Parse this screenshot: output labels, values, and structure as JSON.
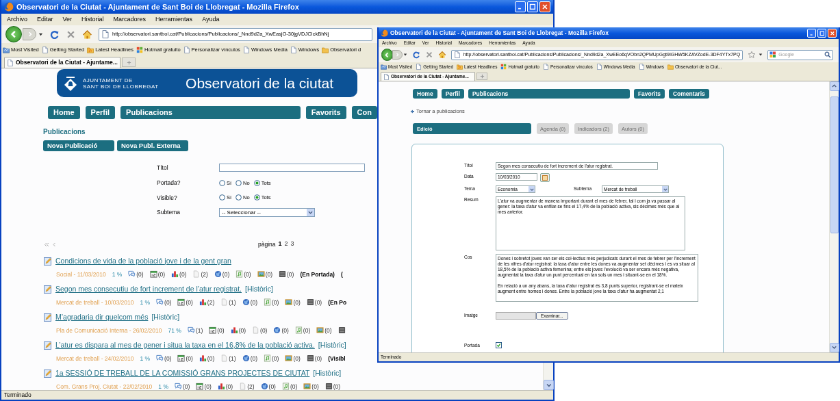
{
  "left_window": {
    "title": "Observatori de la Ciutat - Ajuntament de Sant Boi de Llobregat - Mozilla Firefox",
    "menu": [
      "Archivo",
      "Editar",
      "Ver",
      "Historial",
      "Marcadores",
      "Herramientas",
      "Ayuda"
    ],
    "url": "http://observatori.santboi.cat/Publicacions/Publicacions/_Nnd9d2a_XwEasjO-30jgVDJCIckBhNj",
    "bookmarks": [
      {
        "kind": "smart",
        "label": "Most Visited"
      },
      {
        "kind": "page",
        "label": "Getting Started"
      },
      {
        "kind": "feed",
        "label": "Latest Headlines"
      },
      {
        "kind": "windows",
        "label": "Hotmail gratuito"
      },
      {
        "kind": "page",
        "label": "Personalizar vínculos"
      },
      {
        "kind": "page",
        "label": "Windows Media"
      },
      {
        "kind": "page",
        "label": "Windows"
      },
      {
        "kind": "folder",
        "label": "Observatori d"
      }
    ],
    "tab": "Observatori de la Ciutat - Ajuntame...",
    "status": "Terminado",
    "header": {
      "org_lines": [
        "AJUNTAMENT DE",
        "SANT BOI DE LLOBREGAT"
      ],
      "title": "Observatori de la ciutat"
    },
    "nav": [
      {
        "kind": "normal",
        "label": "Home"
      },
      {
        "kind": "normal",
        "label": "Perfil"
      },
      {
        "kind": "wide",
        "label": "Publicacions"
      },
      {
        "kind": "normal",
        "label": "Favorits"
      },
      {
        "kind": "normal",
        "label": "Con"
      }
    ],
    "section_title": "Publicacions",
    "actions": [
      "Nova Publicació",
      "Nova Publ. Externa"
    ],
    "filters": [
      {
        "kind": "text",
        "label": "Títol"
      },
      {
        "kind": "radio",
        "label": "Portada?",
        "options": [
          {
            "label": "Sí",
            "selected": false
          },
          {
            "label": "No",
            "selected": false
          },
          {
            "label": "Tots",
            "selected": true
          }
        ]
      },
      {
        "kind": "radio",
        "label": "Visible?",
        "options": [
          {
            "label": "Sí",
            "selected": false
          },
          {
            "label": "No",
            "selected": false
          },
          {
            "label": "Tots",
            "selected": true
          }
        ]
      },
      {
        "kind": "select",
        "label": "Subtema",
        "value": "-- Seleccionar --"
      }
    ],
    "pager": {
      "label": "pàgina",
      "pages": [
        {
          "label": "1",
          "selected": true
        },
        {
          "label": "2",
          "selected": false
        },
        {
          "label": "3",
          "selected": false
        }
      ]
    },
    "publications": [
      {
        "title": "Condicions de vida de la població jove i de la gent gran",
        "category_date": "Social - 11/03/2010",
        "percent": "1 %",
        "counts": [
          {
            "kind": "comments",
            "count": "(0)"
          },
          {
            "kind": "calendar",
            "count": "(0)"
          },
          {
            "kind": "chart",
            "count": "(0)"
          },
          {
            "kind": "document",
            "count": "(2)"
          },
          {
            "kind": "globe",
            "count": "(0)"
          },
          {
            "kind": "audio",
            "count": "(0)"
          },
          {
            "kind": "image",
            "count": "(0)"
          },
          {
            "kind": "video",
            "count": "(0)"
          }
        ],
        "flags": [
          "(En Portada)",
          "("
        ]
      },
      {
        "title": "Segon mes consecutiu de fort increment de l’atur registrat.",
        "tag": "[Històric]",
        "category_date": "Mercat de treball - 10/03/2010",
        "percent": "1 %",
        "counts": [
          {
            "kind": "comments",
            "count": "(0)"
          },
          {
            "kind": "calendar",
            "count": "(0)"
          },
          {
            "kind": "chart",
            "count": "(2)"
          },
          {
            "kind": "document",
            "count": "(1)"
          },
          {
            "kind": "globe",
            "count": "(0)"
          },
          {
            "kind": "audio",
            "count": "(0)"
          },
          {
            "kind": "image",
            "count": "(0)"
          },
          {
            "kind": "video",
            "count": "(0)"
          }
        ],
        "flags": [
          "(En Po"
        ]
      },
      {
        "title": "M’agradaria dir quelcom més",
        "tag": "[Històric]",
        "category_date": "Pla de Comunicació Interna - 26/02/2010",
        "percent": "71 %",
        "counts": [
          {
            "kind": "comments",
            "count": "(1)"
          },
          {
            "kind": "calendar",
            "count": "(0)"
          },
          {
            "kind": "chart",
            "count": "(0)"
          },
          {
            "kind": "document",
            "count": "(0)"
          },
          {
            "kind": "globe",
            "count": "(0)"
          },
          {
            "kind": "audio",
            "count": "(0)"
          },
          {
            "kind": "image",
            "count": "(0)"
          },
          {
            "kind": "video"
          }
        ]
      },
      {
        "title": "L’atur es dispara al mes de gener i situa la taxa en el 16,8% de la població activa.",
        "tag": "[Històric]",
        "category_date": "Mercat de treball - 24/02/2010",
        "percent": "1 %",
        "counts": [
          {
            "kind": "comments",
            "count": "(0)"
          },
          {
            "kind": "calendar",
            "count": "(0)"
          },
          {
            "kind": "chart",
            "count": "(0)"
          },
          {
            "kind": "document",
            "count": "(1)"
          },
          {
            "kind": "globe",
            "count": "(0)"
          },
          {
            "kind": "audio",
            "count": "(0)"
          },
          {
            "kind": "image",
            "count": "(0)"
          },
          {
            "kind": "video",
            "count": "(0)"
          }
        ],
        "flags": [
          "(Visibl"
        ]
      },
      {
        "title": "1a SESSIÓ DE TREBALL DE LA COMISSIÓ GRANS PROJECTES DE CIUTAT",
        "tag": "[Històric]",
        "category_date": "Com. Grans Proj. Ciutat - 22/02/2010",
        "percent": "1 %",
        "counts": [
          {
            "kind": "comments",
            "count": "(0)"
          },
          {
            "kind": "calendar",
            "count": "(0)"
          },
          {
            "kind": "chart",
            "count": "(0)"
          },
          {
            "kind": "document",
            "count": "(2)"
          },
          {
            "kind": "globe",
            "count": "(0)"
          },
          {
            "kind": "audio",
            "count": "(0)"
          },
          {
            "kind": "image",
            "count": "(0)"
          },
          {
            "kind": "video",
            "count": "(0)"
          }
        ]
      }
    ]
  },
  "right_window": {
    "title": "Observatori de la Ciutat - Ajuntament de Sant Boi de Llobregat - Mozilla Firefox",
    "menu": [
      "Archivo",
      "Editar",
      "Ver",
      "Historial",
      "Marcadores",
      "Herramientas",
      "Ayuda"
    ],
    "url": "http://observatori.santboi.cat/Publicacions/Publicacions/_Nnd9d2a_XwEEo6qVObn2QPMUpGgt9IGHW5KZAVZodE-3DF4YTx7PQ",
    "search_placeholder": "Google",
    "bookmarks": [
      {
        "kind": "smart",
        "label": "Most Visited"
      },
      {
        "kind": "page",
        "label": "Getting Started"
      },
      {
        "kind": "feed",
        "label": "Latest Headlines"
      },
      {
        "kind": "windows",
        "label": "Hotmail gratuito"
      },
      {
        "kind": "page",
        "label": "Personalizar vínculos"
      },
      {
        "kind": "page",
        "label": "Windows Media"
      },
      {
        "kind": "page",
        "label": "Windows"
      },
      {
        "kind": "folder",
        "label": "Observatori de la Ciut..."
      }
    ],
    "tab": "Observatori de la Ciutat - Ajuntame...",
    "status": "Terminado",
    "nav": [
      {
        "kind": "normal",
        "label": "Home"
      },
      {
        "kind": "normal",
        "label": "Perfil"
      },
      {
        "kind": "wide",
        "label": "Publicacions"
      },
      {
        "kind": "normal",
        "label": "Favorits"
      },
      {
        "kind": "normal",
        "label": "Comentaris"
      }
    ],
    "back_link": "Tornar a publicacions",
    "tabs": [
      {
        "label": "Edició",
        "selected": true
      },
      {
        "label": "Agenda (0)",
        "selected": false
      },
      {
        "label": "Indicadors (2)",
        "selected": false
      },
      {
        "label": "Autors (0)",
        "selected": false
      }
    ],
    "form": [
      {
        "kind": "text",
        "label": "Títol",
        "value": "Segon mes consecutiu de fort increment de l'atur registrat."
      },
      {
        "kind": "date",
        "label": "Data",
        "value": "10/03/2010"
      },
      {
        "kind": "select_pair",
        "label": "Tema",
        "value": "Economia",
        "second_label": "Subtema",
        "second_value": "Mercat de treball"
      },
      {
        "kind": "textarea",
        "label": "Resum",
        "value": "L'atur va augmentar de manera important durant el mes de febrer, tal i com ja va passar al gener: la taxa d'atur va enfilar-se fins el 17,4% de la població activa, sis dècimes més que al mes anterior."
      },
      {
        "kind": "textarea",
        "label": "Cos",
        "value": "Dones i sobretot joves van ser els col·lectius més perjudicats durant el mes de febrer per l'increment de les xifres d'atur registrat: la taxa d'atur entre les dones va augmentar set dècimes i es va situar al 18,5% de la població activa femenina; entre els joves l'evolució va ser encara més negativa, augmentat la taxa d'atur un punt percentual en tan sols un mes i situant-se en el 18%.\n\nEn relació a un any abans, la taxa d'atur registrat és 3,8 punts superior, registrant-se el mateix augment entre homes i dones. Entre la població jove la taxa d'atur ha augmentat 2,1"
      },
      {
        "kind": "file",
        "label": "Imatge",
        "button": "Examinar..."
      },
      {
        "kind": "checkbox",
        "label": "Portada",
        "checked": true
      }
    ]
  }
}
